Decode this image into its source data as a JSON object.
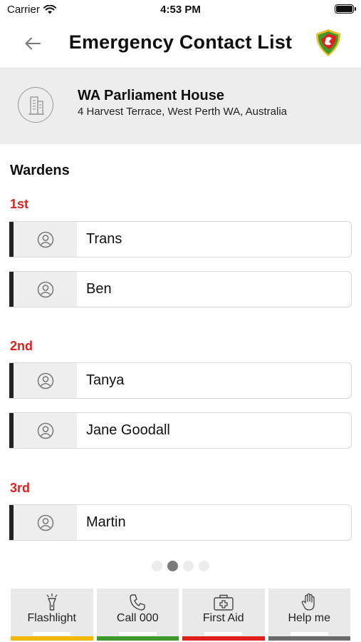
{
  "status_bar": {
    "carrier": "Carrier",
    "time": "4:53 PM"
  },
  "header": {
    "title": "Emergency Contact List"
  },
  "building": {
    "name": "WA Parliament House",
    "address": "4 Harvest Terrace, West Perth WA, Australia"
  },
  "wardens": {
    "heading": "Wardens",
    "groups": [
      {
        "label": "1st",
        "contacts": [
          "Trans",
          "Ben"
        ]
      },
      {
        "label": "2nd",
        "contacts": [
          "Tanya",
          "Jane Goodall"
        ]
      },
      {
        "label": "3rd",
        "contacts": [
          "Martin"
        ]
      }
    ]
  },
  "pagination": {
    "pages": 4,
    "current": 2
  },
  "actions": [
    {
      "label": "Flashlight",
      "icon": "flashlight-icon",
      "color": "#f2b705"
    },
    {
      "label": "Call 000",
      "icon": "phone-icon",
      "color": "#3f9a2e"
    },
    {
      "label": "First Aid",
      "icon": "first-aid-icon",
      "color": "#e0201c"
    },
    {
      "label": "Help me",
      "icon": "hand-icon",
      "color": "#6a6a6a"
    }
  ],
  "colors": {
    "group_label": "#e0201c",
    "card_accent": "#222222",
    "header_bg": "#ededed"
  }
}
